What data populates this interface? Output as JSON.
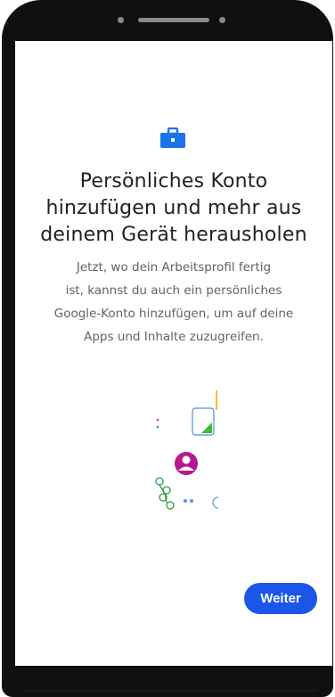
{
  "onboarding": {
    "title": "Persönliches Konto\nhinzufügen und mehr aus\ndeinem Gerät herausholen",
    "description": "Jetzt, wo dein Arbeitsprofil fertig\nist, kannst du auch ein persönliches\nGoogle-Konto hinzufügen, um auf deine\nApps und Inhalte zuzugreifen.",
    "next_label": "Weiter"
  },
  "icons": {
    "header_icon": "briefcase-icon",
    "illustration_avatar": "person-icon"
  },
  "colors": {
    "accent": "#1a56e8",
    "briefcase": "#1a73e8",
    "avatar": "#b5198f",
    "title_text": "#202124",
    "body_text": "#5f6368",
    "frame": "#101010"
  }
}
